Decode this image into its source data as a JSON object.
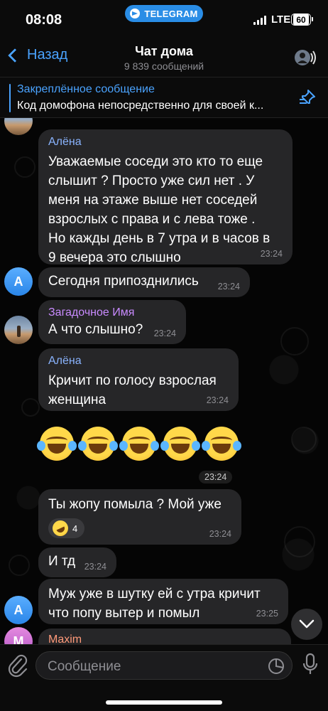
{
  "status_bar": {
    "time": "08:08",
    "app_pill": "TELEGRAM",
    "network": "LTE",
    "battery": "60"
  },
  "header": {
    "back_label": "Назад",
    "title": "Чат дома",
    "subtitle": "9 839 сообщений"
  },
  "pinned": {
    "title": "Закреплённое сообщение",
    "text": "Код домофона непосредственно для своей к..."
  },
  "messages": [
    {
      "sender": "Алёна",
      "sender_color": "#8ab4ff",
      "lines": [
        "Уважаемые соседи это кто то еще",
        "слышит ?  Просто уже сил нет . У",
        "меня на этаже выше нет соседей",
        "взрослых с права и с лева тоже .",
        "Но кажды день в 7 утра и в часов в",
        "9 вечера это слышно"
      ],
      "time": "23:24"
    },
    {
      "avatar_letter": "A",
      "text": "Сегодня припозднились",
      "time": "23:24"
    },
    {
      "sender": "Загадочное Имя",
      "sender_color": "#c98bff",
      "text": "А что слышно?",
      "time": "23:24"
    },
    {
      "sender": "Алёна",
      "sender_color": "#8ab4ff",
      "lines": [
        "Кричит по голосу взрослая",
        "женщина"
      ],
      "time": "23:24"
    },
    {
      "emoji_count": 5,
      "time": "23:24"
    },
    {
      "text": "Ты жопу помыла ? Мой уже",
      "reaction_count": "4",
      "time": "23:24"
    },
    {
      "text": "И тд",
      "time": "23:24"
    },
    {
      "avatar_letter": "A",
      "lines": [
        "Муж уже в шутку ей с утра кричит",
        "что попу вытер и помыл"
      ],
      "time": "23:25"
    },
    {
      "avatar_letter": "M",
      "sender": "Maxim",
      "sender_color": "#ff9a7a"
    }
  ],
  "input": {
    "placeholder": "Сообщение"
  },
  "colors": {
    "accent": "#4aa3ff",
    "bubble": "#262628"
  }
}
